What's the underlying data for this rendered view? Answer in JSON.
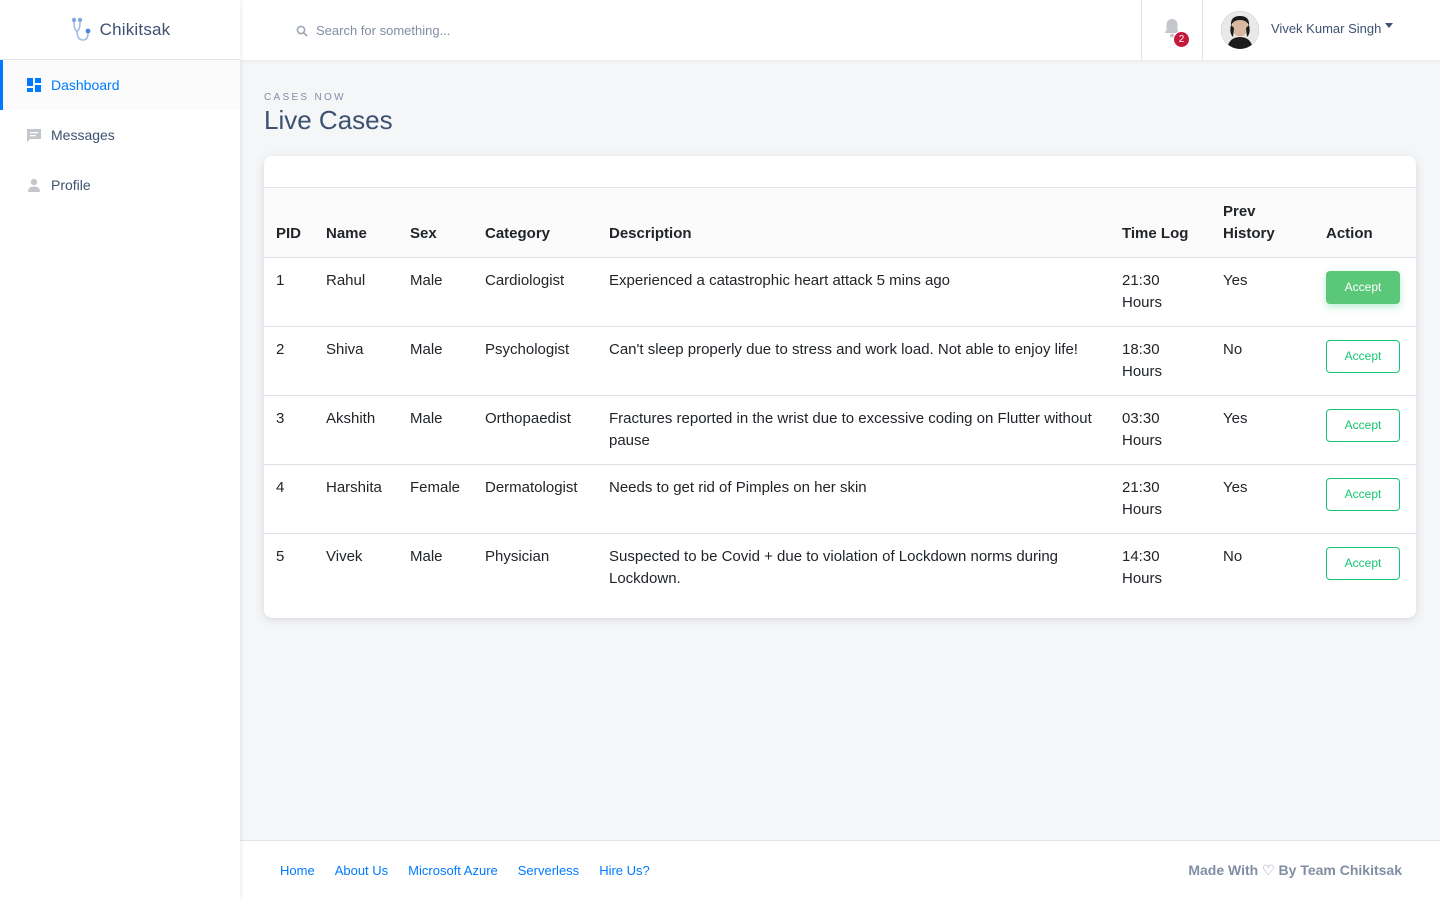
{
  "brand": {
    "name": "Chikitsak"
  },
  "sidebar": {
    "items": [
      {
        "label": "Dashboard",
        "icon": "dashboard-icon",
        "active": true
      },
      {
        "label": "Messages",
        "icon": "message-icon",
        "active": false
      },
      {
        "label": "Profile",
        "icon": "person-icon",
        "active": false
      }
    ]
  },
  "topbar": {
    "search_placeholder": "Search for something...",
    "notification_count": "2",
    "user_name": "Vivek Kumar Singh"
  },
  "page": {
    "subtitle": "CASES NOW",
    "title": "Live Cases"
  },
  "table": {
    "columns": [
      "PID",
      "Name",
      "Sex",
      "Category",
      "Description",
      "Time Log",
      "Prev History",
      "Action"
    ],
    "rows": [
      {
        "pid": "1",
        "name": "Rahul",
        "sex": "Male",
        "category": "Cardiologist",
        "description": "Experienced a catastrophic heart attack 5 mins ago",
        "time_log": "21:30 Hours",
        "prev_history": "Yes",
        "action": "Accept"
      },
      {
        "pid": "2",
        "name": "Shiva",
        "sex": "Male",
        "category": "Psychologist",
        "description": "Can't sleep properly due to stress and work load. Not able to enjoy life!",
        "time_log": "18:30 Hours",
        "prev_history": "No",
        "action": "Accept"
      },
      {
        "pid": "3",
        "name": "Akshith",
        "sex": "Male",
        "category": "Orthopaedist",
        "description": "Fractures reported in the wrist due to excessive coding on Flutter without pause",
        "time_log": "03:30 Hours",
        "prev_history": "Yes",
        "action": "Accept"
      },
      {
        "pid": "4",
        "name": "Harshita",
        "sex": "Female",
        "category": "Dermatologist",
        "description": "Needs to get rid of Pimples on her skin",
        "time_log": "21:30 Hours",
        "prev_history": "Yes",
        "action": "Accept"
      },
      {
        "pid": "5",
        "name": "Vivek",
        "sex": "Male",
        "category": "Physician",
        "description": "Suspected to be Covid + due to violation of Lockdown norms during Lockdown.",
        "time_log": "14:30 Hours",
        "prev_history": "No",
        "action": "Accept"
      }
    ]
  },
  "footer": {
    "links": [
      "Home",
      "About Us",
      "Microsoft Azure",
      "Serverless",
      "Hire Us?"
    ],
    "credit": "Made With ♡ By Team Chikitsak"
  },
  "colors": {
    "accent": "#007bff",
    "success": "#17c671",
    "danger": "#c4183c",
    "text": "#3d5170",
    "muted": "#818ea3"
  }
}
